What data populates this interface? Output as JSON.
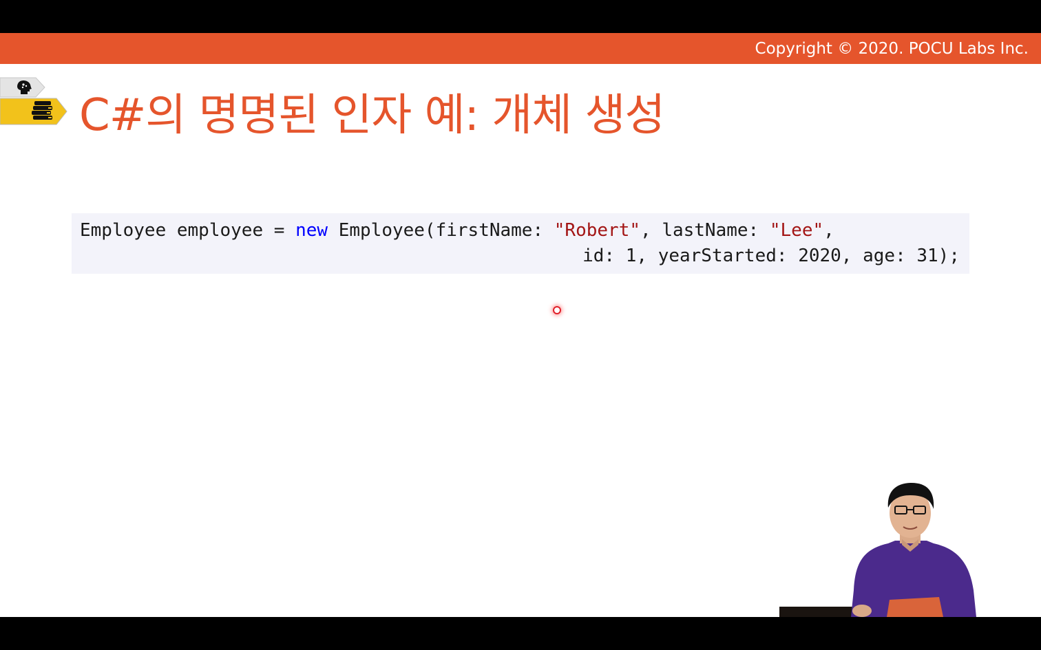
{
  "header": {
    "copyright": "Copyright © 2020. POCU Labs Inc."
  },
  "nav_icons": {
    "top": "brain-head-icon",
    "bottom": "book-stack-icon"
  },
  "slide": {
    "title": "C#의 명명된 인자 예: 개체 생성"
  },
  "code": {
    "line1": {
      "a": "Employee employee = ",
      "kw": "new",
      "b": " Employee(firstName: ",
      "s1": "\"Robert\"",
      "c": ", lastName: ",
      "s2": "\"Lee\"",
      "d": ","
    },
    "line2": "id: 1, yearStarted: 2020, age: 31);"
  },
  "colors": {
    "accent": "#e5552c",
    "code_background": "#f3f3fa",
    "keyword": "#0000ff",
    "string": "#a31515",
    "nav_yellow": "#f2c21b"
  }
}
